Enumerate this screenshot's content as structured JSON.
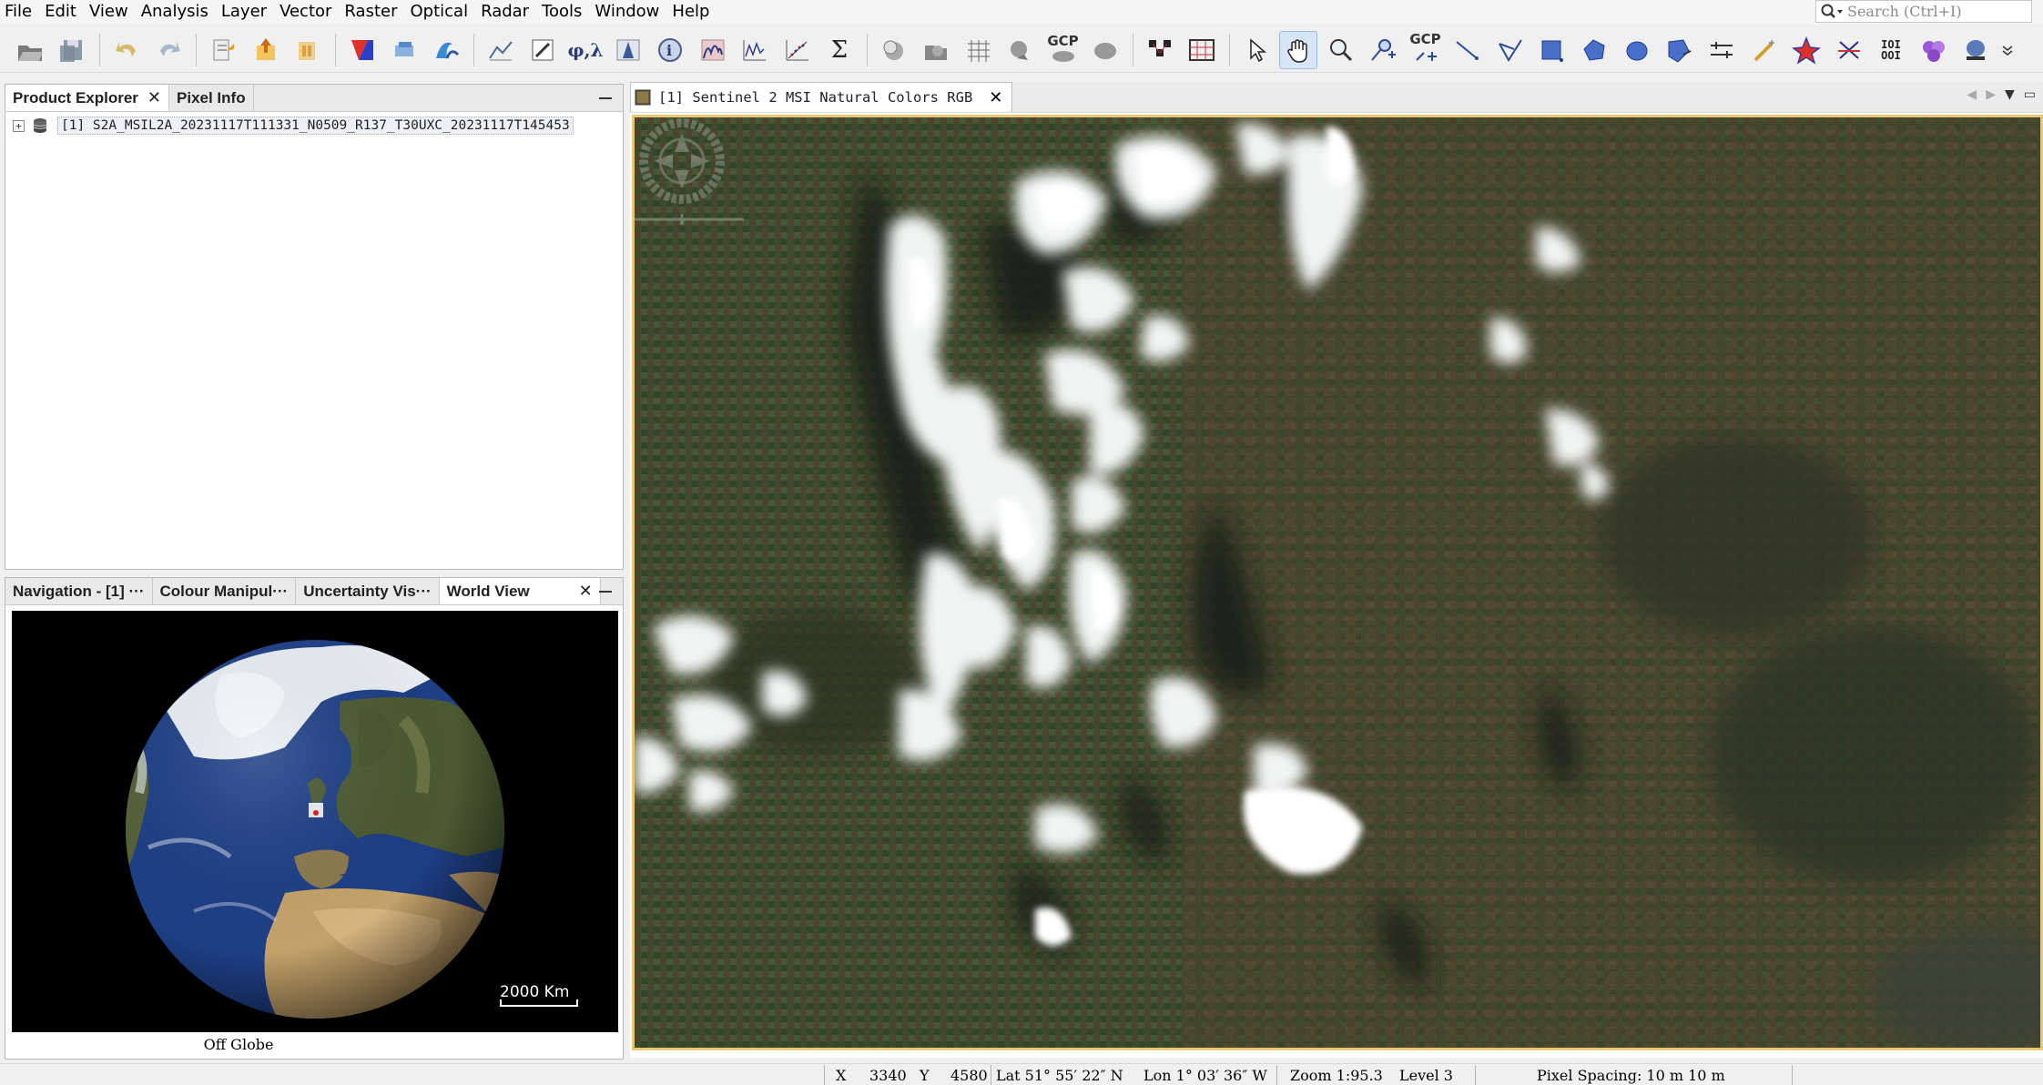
{
  "menu": [
    "File",
    "Edit",
    "View",
    "Analysis",
    "Layer",
    "Vector",
    "Raster",
    "Optical",
    "Radar",
    "Tools",
    "Window",
    "Help"
  ],
  "search": {
    "placeholder": "Search (Ctrl+I)"
  },
  "toolbar": {
    "gcp_label": "GCP",
    "icons": [
      "open-product-icon",
      "save-product-icon",
      "undo-icon",
      "redo-icon",
      "import-vector-icon",
      "export-icon",
      "session-icon",
      "rgb-image-icon",
      "band-maths-icon",
      "wave-icon",
      "graph-builder-icon",
      "pin-manager-icon",
      "band-arithmetic-icon",
      "histogram-icon",
      "information-icon",
      "spectrum-icon",
      "profile-plot-icon",
      "scatter-plot-icon",
      "statistics-icon",
      "mask-manager-icon",
      "layer-manager-icon",
      "graticule-icon",
      "world-map-icon",
      "gcp-manager-icon",
      "overlay-icon",
      "pin-placing-icon",
      "pixel-grid-icon",
      "select-tool-icon",
      "pan-tool-icon",
      "zoom-tool-icon",
      "pin-tool-icon",
      "gcp-tool-icon",
      "line-tool-icon",
      "polyline-tool-icon",
      "rectangle-tool-icon",
      "polygon-tool-icon",
      "ellipse-tool-icon",
      "import-shape-icon",
      "range-finder-icon",
      "magic-wand-icon",
      "star-icon",
      "cross-icon",
      "binary-icon",
      "cluster-icon",
      "globe-tool-icon"
    ]
  },
  "product_explorer": {
    "tabs": [
      "Product Explorer",
      "Pixel Info"
    ],
    "product": "[1] S2A_MSIL2A_20231117T111331_N0509_R137_T30UXC_20231117T145453"
  },
  "bottom_panel": {
    "tabs": [
      "Navigation - [1] ···",
      "Colour Manipul···",
      "Uncertainty Vis···",
      "World View"
    ],
    "scale_label": "2000 Km",
    "off_globe": "Off Globe"
  },
  "image_view": {
    "tab_title": "[1] Sentinel 2 MSI Natural Colors RGB"
  },
  "status": {
    "x_label": "X",
    "x_value": "3340",
    "y_label": "Y",
    "y_value": "4580",
    "lat": "Lat 51° 55′ 22″ N",
    "lon": "Lon 1° 03′ 36″ W",
    "zoom": "Zoom 1:95.3",
    "level": "Level 3",
    "pixel_spacing": "Pixel Spacing: 10 m 10 m"
  },
  "colors": {
    "accent_border": "#e8c872",
    "ocean": "#1e3f86",
    "land": "#3d4a2a"
  }
}
